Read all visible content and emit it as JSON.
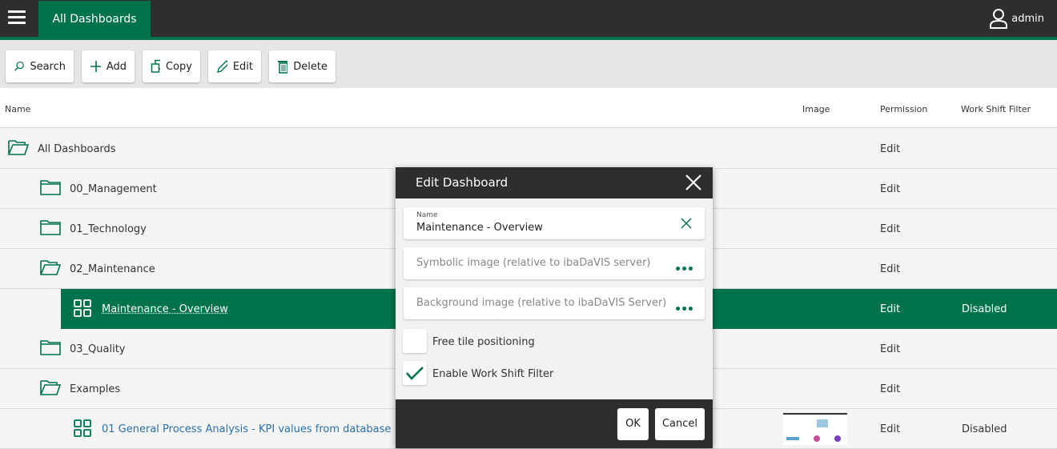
{
  "topbar": {
    "tab": "All Dashboards",
    "user": "admin"
  },
  "toolbar": {
    "search": "Search",
    "add": "Add",
    "copy": "Copy",
    "edit": "Edit",
    "delete": "Delete"
  },
  "table": {
    "headers": {
      "name": "Name",
      "image": "Image",
      "permission": "Permission",
      "wsf": "Work Shift Filter"
    },
    "rows": [
      {
        "label": "All Dashboards",
        "permission": "Edit",
        "wsf": ""
      },
      {
        "label": "00_Management",
        "permission": "Edit",
        "wsf": ""
      },
      {
        "label": "01_Technology",
        "permission": "Edit",
        "wsf": ""
      },
      {
        "label": "02_Maintenance",
        "permission": "Edit",
        "wsf": ""
      },
      {
        "label": "Maintenance - Overview",
        "permission": "Edit",
        "wsf": "Disabled"
      },
      {
        "label": "03_Quality",
        "permission": "Edit",
        "wsf": ""
      },
      {
        "label": "Examples",
        "permission": "Edit",
        "wsf": ""
      },
      {
        "label": "01 General Process Analysis - KPI values from database",
        "permission": "Edit",
        "wsf": "Disabled"
      }
    ]
  },
  "dialog": {
    "title": "Edit Dashboard",
    "name_label": "Name",
    "name_value": "Maintenance - Overview",
    "symbolic_placeholder": "Symbolic image (relative to ibaDaVIS server)",
    "background_placeholder": "Background image (relative to ibaDaVIS Server)",
    "free_tile": "Free tile positioning",
    "free_tile_checked": false,
    "enable_wsf": "Enable Work Shift Filter",
    "enable_wsf_checked": true,
    "ok": "OK",
    "cancel": "Cancel"
  },
  "colors": {
    "accent": "#00734a",
    "dark": "#2e2e2e"
  }
}
